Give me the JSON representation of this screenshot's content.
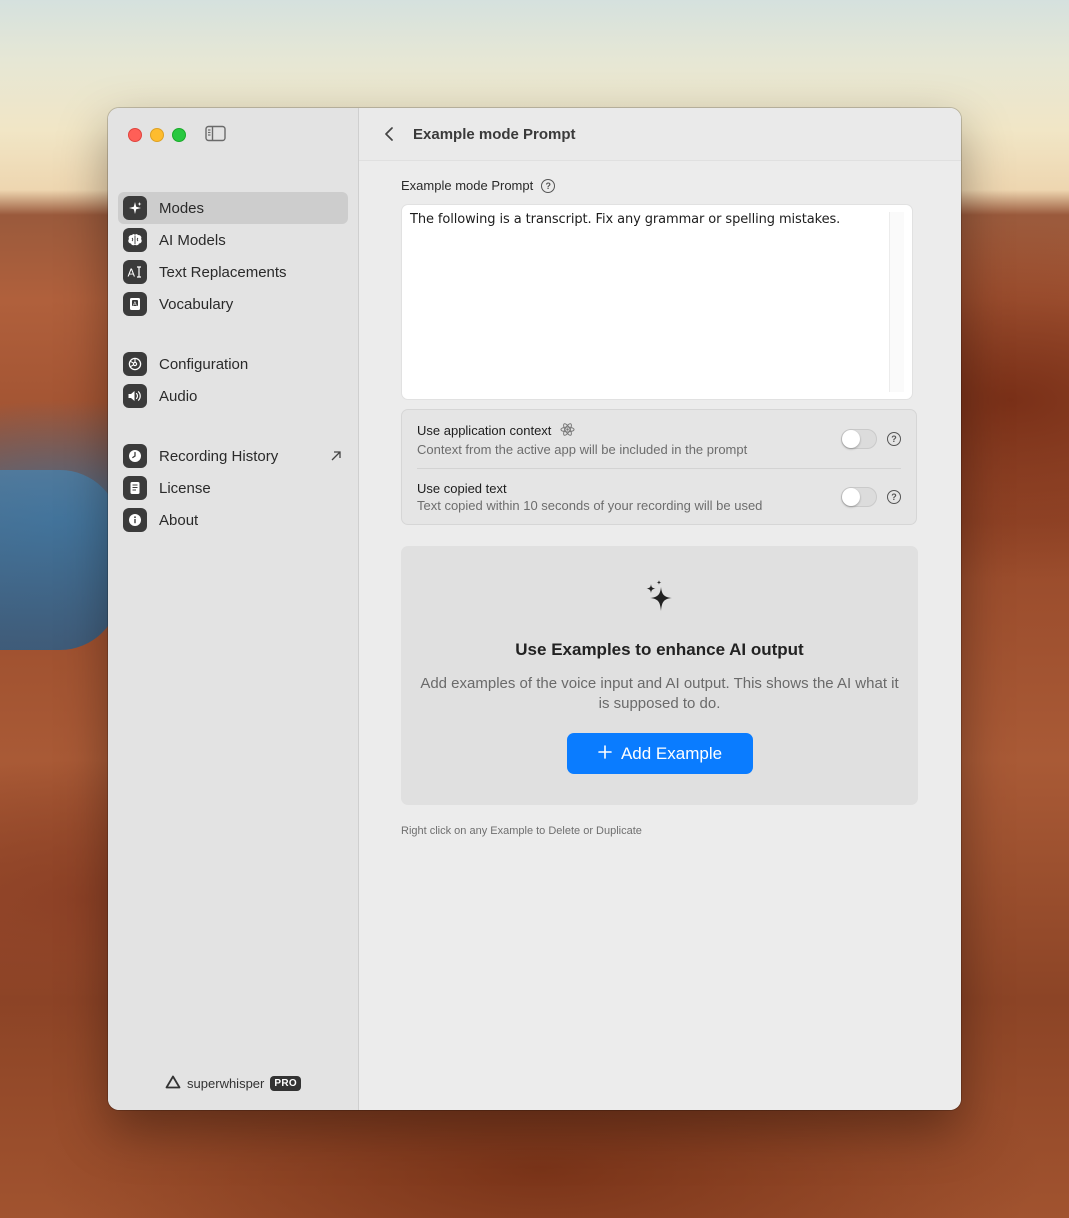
{
  "sidebar": {
    "groups": [
      [
        {
          "label": "Modes",
          "icon": "sparkle-icon",
          "active": true
        },
        {
          "label": "AI Models",
          "icon": "brain-icon"
        },
        {
          "label": "Text Replacements",
          "icon": "text-cursor-icon"
        },
        {
          "label": "Vocabulary",
          "icon": "book-icon"
        }
      ],
      [
        {
          "label": "Configuration",
          "icon": "gear-icon"
        },
        {
          "label": "Audio",
          "icon": "speaker-icon"
        }
      ],
      [
        {
          "label": "Recording History",
          "icon": "clock-icon",
          "external": true
        },
        {
          "label": "License",
          "icon": "document-icon"
        },
        {
          "label": "About",
          "icon": "info-icon"
        }
      ]
    ],
    "brand": {
      "name": "superwhisper",
      "badge": "PRO"
    }
  },
  "header": {
    "title": "Example mode Prompt"
  },
  "prompt": {
    "label": "Example mode Prompt",
    "text": "The following is a transcript. Fix any grammar or spelling mistakes."
  },
  "toggles": [
    {
      "title": "Use application context",
      "subtitle": "Context from the active app will be included in the prompt",
      "on": false
    },
    {
      "title": "Use copied text",
      "subtitle": "Text copied within 10 seconds of your recording will be used",
      "on": false
    }
  ],
  "examples": {
    "title": "Use Examples to enhance AI output",
    "description": "Add examples of the voice input and AI output. This shows the AI what it is supposed to do.",
    "button_label": "Add Example"
  },
  "hint": "Right click on any Example to Delete or Duplicate",
  "colors": {
    "accent": "#0a7cff",
    "sidebar_bg": "#e3e3e3",
    "content_bg": "#ececec"
  }
}
